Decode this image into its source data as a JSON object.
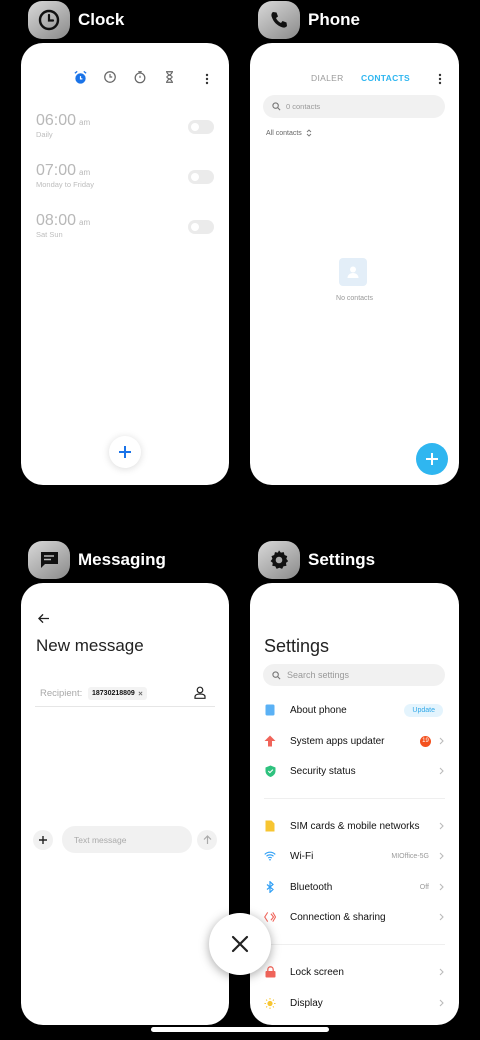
{
  "apps": {
    "clock": {
      "title": "Clock",
      "alarms": [
        {
          "time": "06:00",
          "ampm": "am",
          "repeat": "Daily"
        },
        {
          "time": "07:00",
          "ampm": "am",
          "repeat": "Monday to Friday"
        },
        {
          "time": "08:00",
          "ampm": "am",
          "repeat": "Sat Sun"
        }
      ]
    },
    "phone": {
      "title": "Phone",
      "tabs": [
        "DIALER",
        "CONTACTS"
      ],
      "search_placeholder": "0 contacts",
      "filter_label": "All contacts",
      "empty_text": "No contacts"
    },
    "messaging": {
      "title": "Messaging",
      "heading": "New message",
      "recipient_label": "Recipient:",
      "recipient_chip": "18730218809",
      "message_placeholder": "Text message"
    },
    "settings": {
      "title": "Settings",
      "heading": "Settings",
      "search_placeholder": "Search settings",
      "rows": [
        {
          "label": "About phone",
          "action": "Update"
        },
        {
          "label": "System apps updater",
          "badge": "19"
        },
        {
          "label": "Security status"
        },
        {
          "label": "SIM cards & mobile networks"
        },
        {
          "label": "Wi-Fi",
          "value": "MIOffice-5G"
        },
        {
          "label": "Bluetooth",
          "value": "Off"
        },
        {
          "label": "Connection & sharing"
        },
        {
          "label": "Lock screen"
        },
        {
          "label": "Display"
        }
      ]
    }
  },
  "colors": {
    "accent": "#1a73e8",
    "phone_accent": "#2fb6f0",
    "badge": "#f4511e"
  }
}
